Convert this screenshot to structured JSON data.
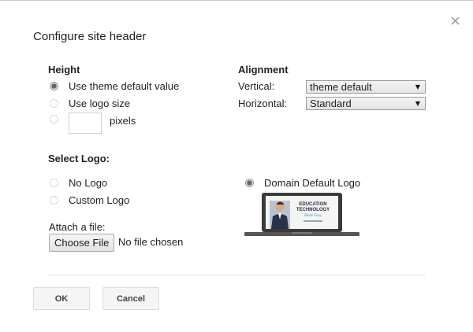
{
  "dialog": {
    "title": "Configure site header",
    "close_glyph": "×"
  },
  "height": {
    "heading": "Height",
    "options": [
      {
        "label": "Use theme default value",
        "selected": true
      },
      {
        "label": "Use logo size",
        "selected": false
      },
      {
        "label": "pixels",
        "selected": false,
        "value": ""
      }
    ]
  },
  "alignment": {
    "heading": "Alignment",
    "vertical_label": "Vertical:",
    "vertical_value": "theme default",
    "horizontal_label": "Horizontal:",
    "horizontal_value": "Standard"
  },
  "logo": {
    "heading": "Select Logo:",
    "no_logo": "No Logo",
    "custom_logo": "Custom Logo",
    "domain_default": "Domain Default Logo",
    "selected": "Domain Default Logo",
    "preview_text_1": "EDUCATION",
    "preview_text_2": "TECHNOLOGY",
    "preview_text_3": "Made Easy"
  },
  "attach": {
    "label": "Attach a file:",
    "button": "Choose File",
    "status": "No file chosen"
  },
  "footer": {
    "ok": "OK",
    "cancel": "Cancel"
  },
  "icons": {
    "close": "close-icon",
    "dropdown": "triangle-down-icon"
  }
}
